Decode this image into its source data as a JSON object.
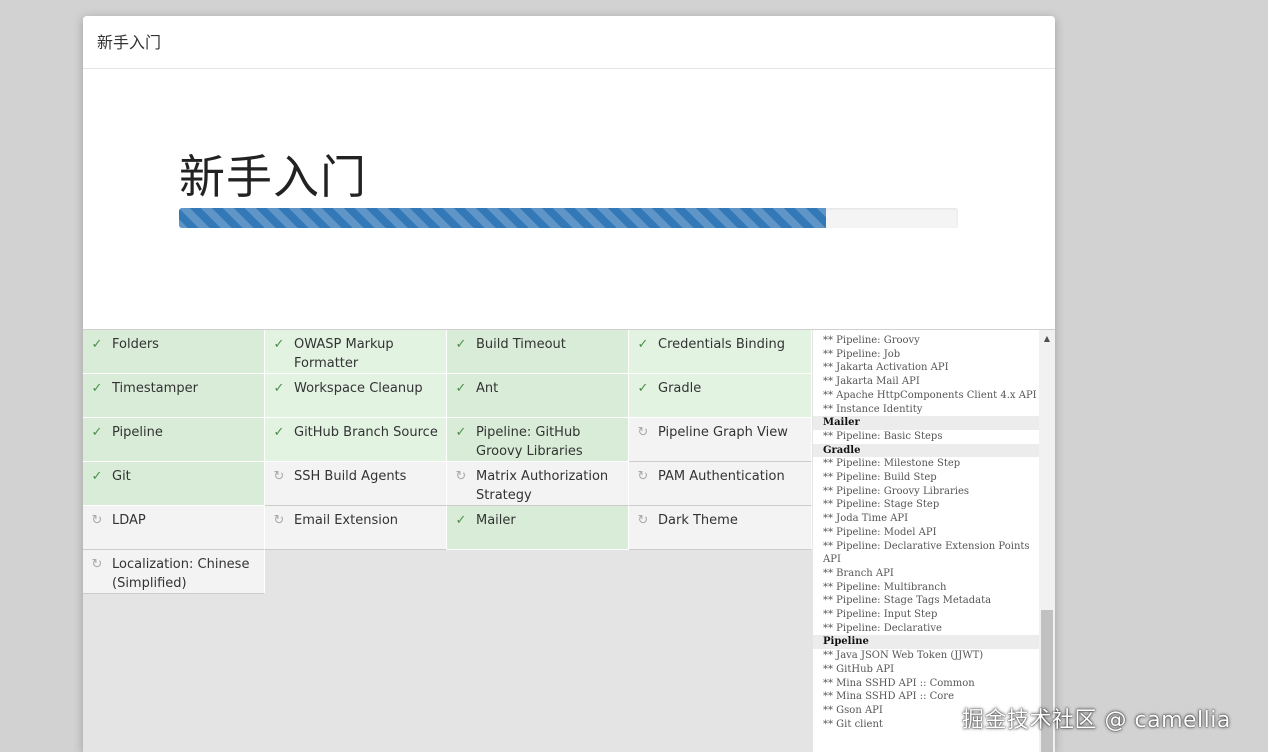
{
  "dialog": {
    "title": "新手入门",
    "heading": "新手入门",
    "progress_percent": 83
  },
  "plugins": [
    {
      "name": "Folders",
      "status": "done",
      "icon": "check-icon"
    },
    {
      "name": "OWASP Markup Formatter",
      "status": "done",
      "icon": "check-icon"
    },
    {
      "name": "Build Timeout",
      "status": "done",
      "icon": "check-icon"
    },
    {
      "name": "Credentials Binding",
      "status": "done",
      "icon": "check-icon"
    },
    {
      "name": "Timestamper",
      "status": "done",
      "icon": "check-icon"
    },
    {
      "name": "Workspace Cleanup",
      "status": "done",
      "icon": "check-icon"
    },
    {
      "name": "Ant",
      "status": "done",
      "icon": "check-icon"
    },
    {
      "name": "Gradle",
      "status": "done",
      "icon": "check-icon"
    },
    {
      "name": "Pipeline",
      "status": "done",
      "icon": "check-icon"
    },
    {
      "name": "GitHub Branch Source",
      "status": "done",
      "icon": "check-icon"
    },
    {
      "name": "Pipeline: GitHub Groovy Libraries",
      "status": "done",
      "icon": "check-icon"
    },
    {
      "name": "Pipeline Graph View",
      "status": "pending",
      "icon": "refresh-icon"
    },
    {
      "name": "Git",
      "status": "done",
      "icon": "check-icon"
    },
    {
      "name": "SSH Build Agents",
      "status": "pending",
      "icon": "refresh-icon"
    },
    {
      "name": "Matrix Authorization Strategy",
      "status": "pending",
      "icon": "refresh-icon"
    },
    {
      "name": "PAM Authentication",
      "status": "pending",
      "icon": "refresh-icon"
    },
    {
      "name": "LDAP",
      "status": "pending",
      "icon": "refresh-icon"
    },
    {
      "name": "Email Extension",
      "status": "pending",
      "icon": "refresh-icon"
    },
    {
      "name": "Mailer",
      "status": "done",
      "icon": "check-icon"
    },
    {
      "name": "Dark Theme",
      "status": "pending",
      "icon": "refresh-icon"
    },
    {
      "name": "Localization: Chinese (Simplified)",
      "status": "pending",
      "icon": "refresh-icon"
    }
  ],
  "log": [
    {
      "text": "** Pipeline: Groovy",
      "type": "dep"
    },
    {
      "text": "** Pipeline: Job",
      "type": "dep"
    },
    {
      "text": "** Jakarta Activation API",
      "type": "dep"
    },
    {
      "text": "** Jakarta Mail API",
      "type": "dep"
    },
    {
      "text": "** Apache HttpComponents Client 4.x API",
      "type": "wrap"
    },
    {
      "text": "** Instance Identity",
      "type": "dep"
    },
    {
      "text": "Mailer",
      "type": "head"
    },
    {
      "text": "** Pipeline: Basic Steps",
      "type": "dep"
    },
    {
      "text": "Gradle",
      "type": "head"
    },
    {
      "text": "** Pipeline: Milestone Step",
      "type": "dep"
    },
    {
      "text": "** Pipeline: Build Step",
      "type": "dep"
    },
    {
      "text": "** Pipeline: Groovy Libraries",
      "type": "dep"
    },
    {
      "text": "** Pipeline: Stage Step",
      "type": "dep"
    },
    {
      "text": "** Joda Time API",
      "type": "dep"
    },
    {
      "text": "** Pipeline: Model API",
      "type": "dep"
    },
    {
      "text": "** Pipeline: Declarative Extension Points API",
      "type": "wrap"
    },
    {
      "text": "** Branch API",
      "type": "dep"
    },
    {
      "text": "** Pipeline: Multibranch",
      "type": "dep"
    },
    {
      "text": "** Pipeline: Stage Tags Metadata",
      "type": "dep"
    },
    {
      "text": "** Pipeline: Input Step",
      "type": "dep"
    },
    {
      "text": "** Pipeline: Declarative",
      "type": "dep"
    },
    {
      "text": "Pipeline",
      "type": "head"
    },
    {
      "text": "** Java JSON Web Token (JJWT)",
      "type": "dep"
    },
    {
      "text": "** GitHub API",
      "type": "dep"
    },
    {
      "text": "** Mina SSHD API :: Common",
      "type": "dep"
    },
    {
      "text": "** Mina SSHD API :: Core",
      "type": "dep"
    },
    {
      "text": "** Gson API",
      "type": "dep"
    },
    {
      "text": "** Git client",
      "type": "dep"
    }
  ],
  "watermark": "掘金技术社区 @ camellia",
  "colors": {
    "progress": "#3379b7",
    "done_cell": "#d8ecd8",
    "pending_cell": "#f3f3f3",
    "check": "#4a8f4a"
  }
}
